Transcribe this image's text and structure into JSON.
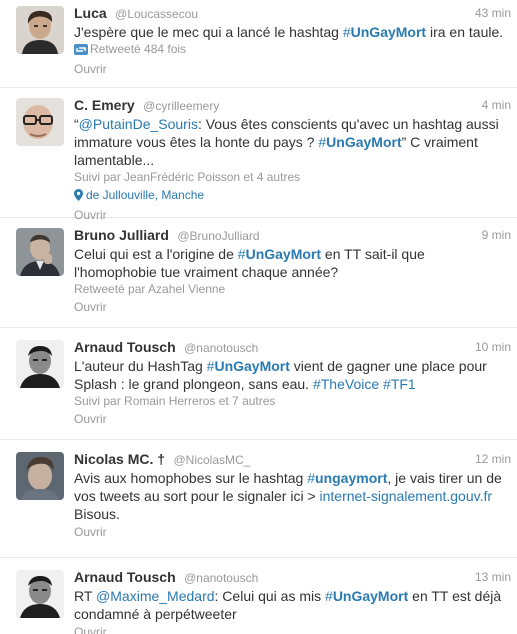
{
  "tweets": [
    {
      "fullname": "Luca",
      "username": "@Loucassecou",
      "time": "43 min",
      "text": {
        "t1": "J'espère que le mec qui a lancé le hashtag ",
        "h1": "UnGayMort",
        "t2": " ira en taule."
      },
      "retweet_count_label": "Retweeté 484 fois",
      "open_label": "Ouvrir"
    },
    {
      "fullname": "C. Emery",
      "username": "@cyrilleemery",
      "time": "4 min",
      "text": {
        "q1": "“",
        "m1": "PutainDe_Souris",
        "t1": ": Vous êtes conscients qu'avec un hashtag aussi immature vous êtes la honte du pays ? ",
        "h1": "UnGayMort",
        "t2": "” C vraiment lamentable..."
      },
      "followed_by": "Suivi par JeanFrédéric Poisson et 4 autres",
      "location": "de Jullouville, Manche",
      "open_label": "Ouvrir"
    },
    {
      "fullname": "Bruno Julliard",
      "username": "@BrunoJulliard",
      "time": "9 min",
      "text": {
        "t1": "Celui qui est a l'origine de ",
        "h1": "UnGayMort",
        "t2": " en TT sait-il que l'homophobie tue vraiment chaque année?"
      },
      "retweeted_by": "Retweeté par Azahel Vienne",
      "open_label": "Ouvrir"
    },
    {
      "fullname": "Arnaud Tousch",
      "username": "@nanotousch",
      "time": "10 min",
      "text": {
        "t1": "L'auteur du HashTag ",
        "h1": "UnGayMort",
        "t2": " vient de gagner une place pour Splash : le grand plongeon, sans eau. ",
        "h2": "TheVoice",
        "t3": " ",
        "h3": "TF1"
      },
      "followed_by": "Suivi par Romain Herreros et 7 autres",
      "open_label": "Ouvrir"
    },
    {
      "fullname": "Nicolas MC. †",
      "username": "@NicolasMC_",
      "time": "12 min",
      "text": {
        "t1": "Avis aux homophobes sur le hashtag ",
        "h1": "ungaymort",
        "t2": ", je vais tirer un de vos tweets au sort pour le signaler ici > ",
        "l1": "internet-signalement.gouv.fr",
        "t3": " Bisous."
      },
      "open_label": "Ouvrir"
    },
    {
      "fullname": "Arnaud Tousch",
      "username": "@nanotousch",
      "time": "13 min",
      "text": {
        "t1": "RT ",
        "m1": "Maxime_Medard",
        "t2": ": Celui qui as mis ",
        "h1": "UnGayMort",
        "t3": " en TT est déjà condamné à perpétweeter"
      },
      "open_label": "Ouvrir"
    }
  ],
  "icons": {
    "retweet": "retweet-icon",
    "location": "location-pin-icon"
  },
  "colors": {
    "link": "#2a7ab0",
    "muted": "#999999",
    "text": "#333333",
    "separator": "#e8e8e8"
  }
}
